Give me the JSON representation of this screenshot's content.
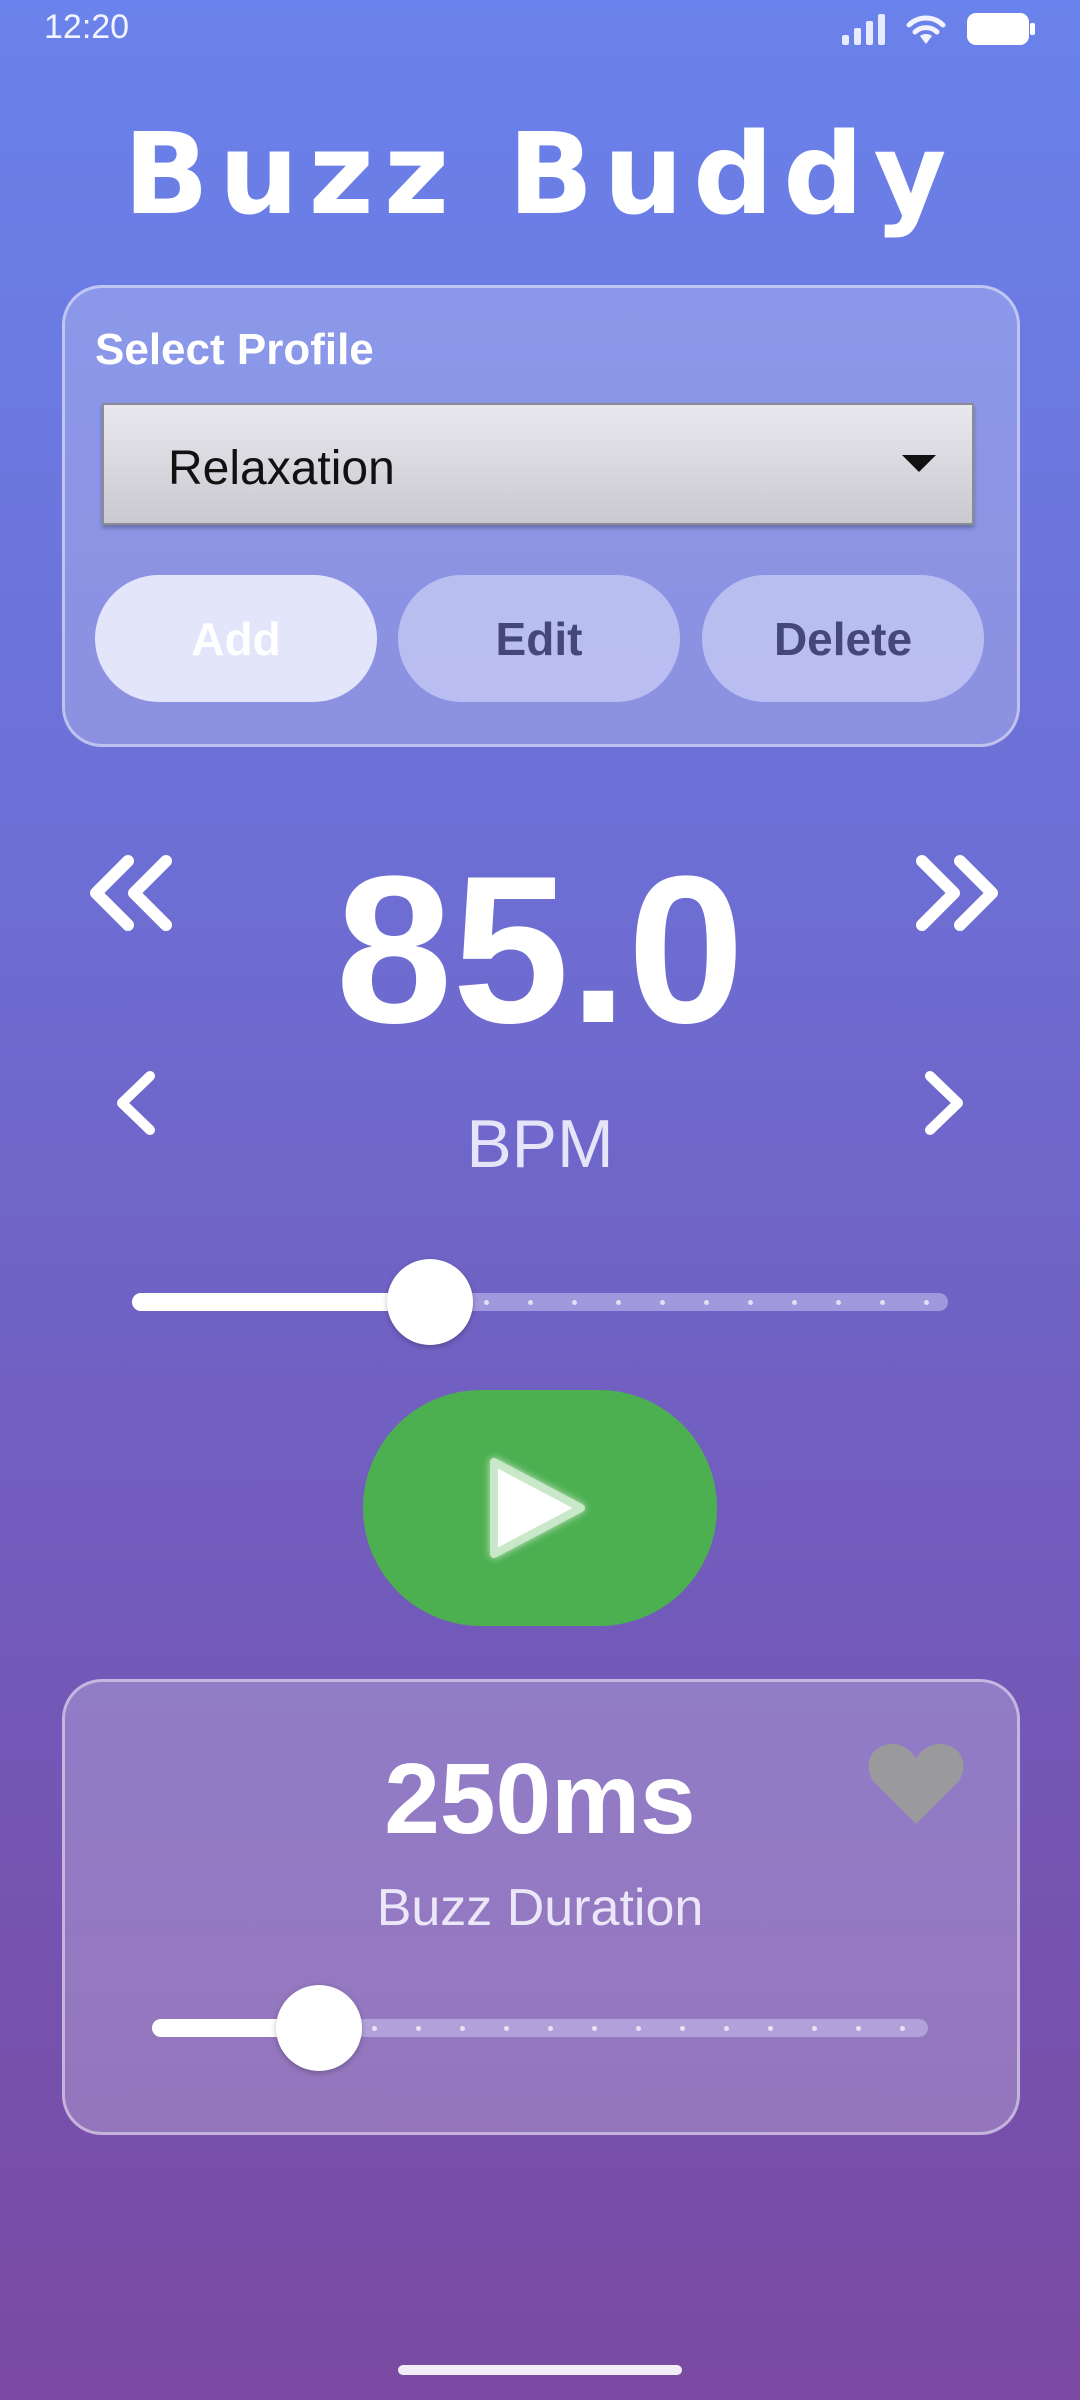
{
  "status_bar": {
    "time": "12:20"
  },
  "app": {
    "title": "Buzz Buddy"
  },
  "profile": {
    "label": "Select Profile",
    "selected": "Relaxation",
    "buttons": {
      "add": "Add",
      "edit": "Edit",
      "delete": "Delete"
    }
  },
  "tempo": {
    "value": "85.0",
    "unit": "BPM",
    "slider_fraction": 0.365,
    "icons": [
      "double-chevron-left-icon",
      "double-chevron-right-icon",
      "chevron-left-icon",
      "chevron-right-icon"
    ]
  },
  "playback": {
    "icon": "play-icon",
    "color": "#4caf50"
  },
  "duration": {
    "value": "250ms",
    "label": "Buzz Duration",
    "slider_fraction": 0.215,
    "favorite_icon": "heart-icon"
  }
}
